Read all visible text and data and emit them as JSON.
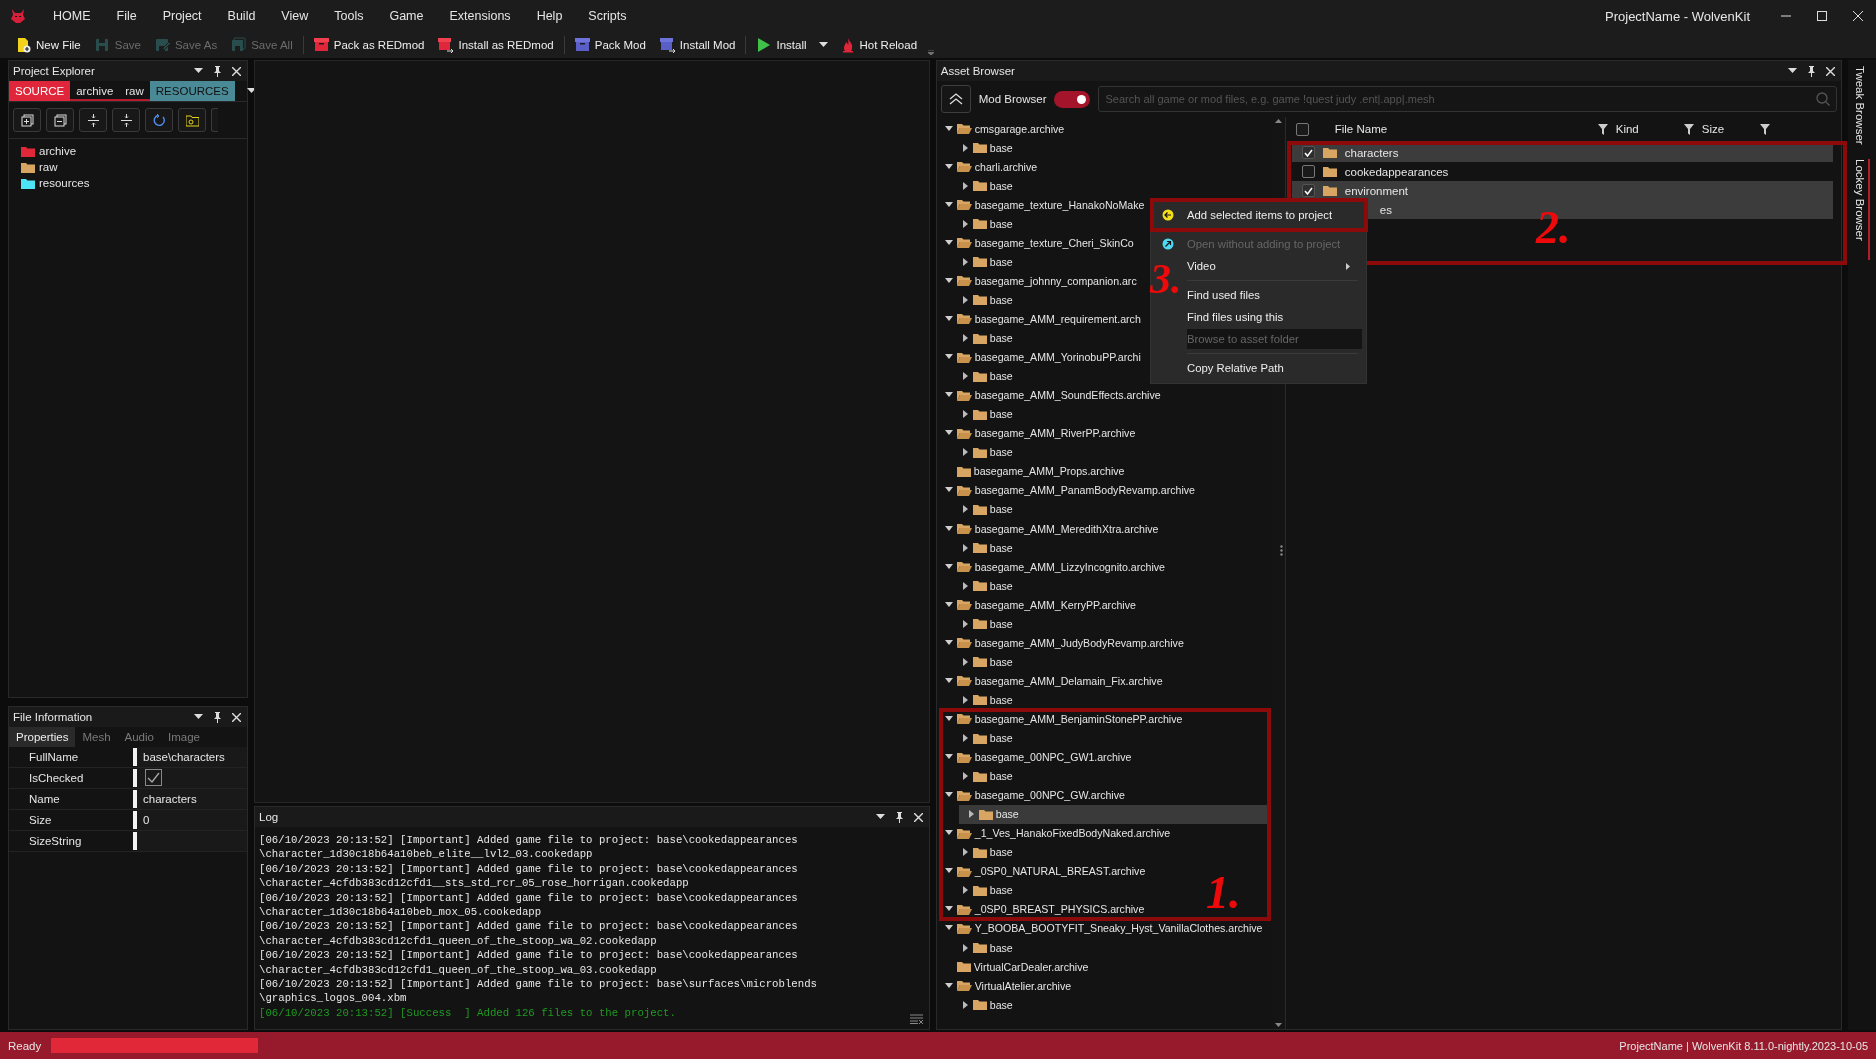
{
  "window": {
    "title": "ProjectName - WolvenKit"
  },
  "menu": [
    "HOME",
    "File",
    "Project",
    "Build",
    "View",
    "Tools",
    "Game",
    "Extensions",
    "Help",
    "Scripts"
  ],
  "toolbar": [
    [
      {
        "label": "New File",
        "kind": "new",
        "disabled": false
      },
      {
        "label": "Save",
        "kind": "save",
        "disabled": true
      },
      {
        "label": "Save As",
        "kind": "save-as",
        "disabled": true
      },
      {
        "label": "Save All",
        "kind": "save-all",
        "disabled": true
      }
    ],
    [
      {
        "label": "Pack as REDmod",
        "kind": "pack-red",
        "disabled": false
      },
      {
        "label": "Install as REDmod",
        "kind": "install-red",
        "disabled": false
      }
    ],
    [
      {
        "label": "Pack Mod",
        "kind": "pack-blue",
        "disabled": false
      },
      {
        "label": "Install Mod",
        "kind": "install-blue",
        "disabled": false
      }
    ],
    [
      {
        "label": "Install",
        "kind": "play",
        "disabled": false,
        "dropdown": true
      },
      {
        "label": "Hot Reload",
        "kind": "flame",
        "disabled": false
      }
    ]
  ],
  "project_explorer": {
    "title": "Project Explorer",
    "tabs": [
      {
        "label": "SOURCE",
        "color": "#e0263a"
      },
      {
        "label": "archive"
      },
      {
        "label": "raw"
      },
      {
        "label": "RESOURCES",
        "color": "#4a8a96"
      }
    ],
    "tree": [
      {
        "label": "archive",
        "color": "#e0283a"
      },
      {
        "label": "raw",
        "color": "#d8a662"
      },
      {
        "label": "resources",
        "color": "#4ee3f5"
      }
    ]
  },
  "file_information": {
    "title": "File Information",
    "tabs": [
      {
        "label": "Properties",
        "selected": true
      },
      {
        "label": "Mesh",
        "selected": false
      },
      {
        "label": "Audio",
        "selected": false
      },
      {
        "label": "Image",
        "selected": false
      }
    ],
    "properties": [
      {
        "name": "FullName",
        "kind": "text",
        "value": "base\\characters"
      },
      {
        "name": "IsChecked",
        "kind": "checkbox",
        "checked": true
      },
      {
        "name": "Name",
        "kind": "text",
        "value": "characters"
      },
      {
        "name": "Size",
        "kind": "text",
        "value": "0"
      },
      {
        "name": "SizeString",
        "kind": "empty"
      }
    ]
  },
  "log": {
    "title": "Log",
    "lines": [
      {
        "text": "[06/10/2023 20:13:52] [Important] Added game file to project: base\\cookedappearances",
        "kind": "info"
      },
      {
        "text": "\\character_1d30c18b64a10beb_elite__lvl2_03.cookedapp",
        "kind": "info"
      },
      {
        "text": "[06/10/2023 20:13:52] [Important] Added game file to project: base\\cookedappearances",
        "kind": "info"
      },
      {
        "text": "\\character_4cfdb383cd12cfd1__sts_std_rcr_05_rose_horrigan.cookedapp",
        "kind": "info"
      },
      {
        "text": "[06/10/2023 20:13:52] [Important] Added game file to project: base\\cookedappearances",
        "kind": "info"
      },
      {
        "text": "\\character_1d30c18b64a10beb_mox_05.cookedapp",
        "kind": "info"
      },
      {
        "text": "[06/10/2023 20:13:52] [Important] Added game file to project: base\\cookedappearances",
        "kind": "info"
      },
      {
        "text": "\\character_4cfdb383cd12cfd1_queen_of_the_stoop_wa_02.cookedapp",
        "kind": "info"
      },
      {
        "text": "[06/10/2023 20:13:52] [Important] Added game file to project: base\\cookedappearances",
        "kind": "info"
      },
      {
        "text": "\\character_4cfdb383cd12cfd1_queen_of_the_stoop_wa_03.cookedapp",
        "kind": "info"
      },
      {
        "text": "[06/10/2023 20:13:52] [Important] Added game file to project: base\\surfaces\\microblends",
        "kind": "info"
      },
      {
        "text": "\\graphics_logos_004.xbm",
        "kind": "info"
      },
      {
        "text": "[06/10/2023 20:13:52] [Success  ] Added 126 files to the project.",
        "kind": "success"
      }
    ]
  },
  "asset_browser": {
    "title": "Asset Browser",
    "mod_browser": {
      "label": "Mod Browser",
      "on": true
    },
    "search": {
      "placeholder": "Search all game or mod files, e.g. game !quest judy .ent|.app|.mesh"
    },
    "tree": [
      {
        "label": "cmsgarage.archive",
        "expanded": true,
        "selected": false,
        "children": [
          {
            "label": "base",
            "expanded": false,
            "selected": false
          }
        ]
      },
      {
        "label": "charli.archive",
        "expanded": true,
        "selected": false,
        "children": [
          {
            "label": "base",
            "expanded": false,
            "selected": false
          }
        ]
      },
      {
        "label": "basegame_texture_HanakoNoMake",
        "expanded": true,
        "selected": false,
        "children": [
          {
            "label": "base",
            "expanded": false,
            "selected": false
          }
        ]
      },
      {
        "label": "basegame_texture_Cheri_SkinCo",
        "expanded": true,
        "selected": false,
        "children": [
          {
            "label": "base",
            "expanded": false,
            "selected": false
          }
        ]
      },
      {
        "label": "basegame_johnny_companion.arc",
        "expanded": true,
        "selected": false,
        "children": [
          {
            "label": "base",
            "expanded": false,
            "selected": false
          }
        ]
      },
      {
        "label": "basegame_AMM_requirement.arch",
        "expanded": true,
        "selected": false,
        "children": [
          {
            "label": "base",
            "expanded": false,
            "selected": false
          }
        ]
      },
      {
        "label": "basegame_AMM_YorinobuPP.archi",
        "expanded": true,
        "selected": false,
        "children": [
          {
            "label": "base",
            "expanded": false,
            "selected": false
          }
        ]
      },
      {
        "label": "basegame_AMM_SoundEffects.archive",
        "expanded": true,
        "selected": false,
        "children": [
          {
            "label": "base",
            "expanded": false,
            "selected": false
          }
        ]
      },
      {
        "label": "basegame_AMM_RiverPP.archive",
        "expanded": true,
        "selected": false,
        "children": [
          {
            "label": "base",
            "expanded": false,
            "selected": false
          }
        ]
      },
      {
        "label": "basegame_AMM_Props.archive",
        "selected": false
      },
      {
        "label": "basegame_AMM_PanamBodyRevamp.archive",
        "expanded": true,
        "selected": false,
        "children": [
          {
            "label": "base",
            "expanded": false,
            "selected": false
          }
        ]
      },
      {
        "label": "basegame_AMM_MeredithXtra.archive",
        "expanded": true,
        "selected": false,
        "children": [
          {
            "label": "base",
            "expanded": false,
            "selected": false
          }
        ]
      },
      {
        "label": "basegame_AMM_LizzyIncognito.archive",
        "expanded": true,
        "selected": false,
        "children": [
          {
            "label": "base",
            "expanded": false,
            "selected": false
          }
        ]
      },
      {
        "label": "basegame_AMM_KerryPP.archive",
        "expanded": true,
        "selected": false,
        "children": [
          {
            "label": "base",
            "expanded": false,
            "selected": false
          }
        ]
      },
      {
        "label": "basegame_AMM_JudyBodyRevamp.archive",
        "expanded": true,
        "selected": false,
        "children": [
          {
            "label": "base",
            "expanded": false,
            "selected": false
          }
        ]
      },
      {
        "label": "basegame_AMM_Delamain_Fix.archive",
        "expanded": true,
        "selected": false,
        "children": [
          {
            "label": "base",
            "expanded": false,
            "selected": false
          }
        ]
      },
      {
        "label": "basegame_AMM_BenjaminStonePP.archive",
        "expanded": true,
        "selected": false,
        "children": [
          {
            "label": "base",
            "expanded": false,
            "selected": false
          }
        ]
      },
      {
        "label": "basegame_00NPC_GW1.archive",
        "expanded": true,
        "selected": false,
        "children": [
          {
            "label": "base",
            "expanded": false,
            "selected": false
          }
        ]
      },
      {
        "label": "basegame_00NPC_GW.archive",
        "expanded": true,
        "selected": false,
        "children": [
          {
            "label": "base",
            "expanded": false,
            "selected": true
          }
        ]
      },
      {
        "label": "_1_Ves_HanakoFixedBodyNaked.archive",
        "expanded": true,
        "selected": false,
        "children": [
          {
            "label": "base",
            "expanded": false,
            "selected": false
          }
        ]
      },
      {
        "label": "_0SP0_NATURAL_BREAST.archive",
        "expanded": true,
        "selected": false,
        "children": [
          {
            "label": "base",
            "expanded": false,
            "selected": false
          }
        ]
      },
      {
        "label": "_0SP0_BREAST_PHYSICS.archive",
        "expanded": true,
        "selected": false
      },
      {
        "label": "Y_BOOBA_BOOTYFIT_Sneaky_Hyst_VanillaClothes.archive",
        "expanded": true,
        "selected": false,
        "children": [
          {
            "label": "base",
            "expanded": false,
            "selected": false
          }
        ]
      },
      {
        "label": "VirtualCarDealer.archive",
        "selected": false
      },
      {
        "label": "VirtualAtelier.archive",
        "expanded": true,
        "selected": false,
        "children": [
          {
            "label": "base",
            "expanded": false,
            "selected": false
          }
        ]
      }
    ],
    "file_list": {
      "columns": [
        "File Name",
        "Kind",
        "Size"
      ],
      "all_checked": false,
      "rows": [
        {
          "name": "characters",
          "checked": true,
          "selected": true
        },
        {
          "name": "cookedappearances",
          "checked": false,
          "selected": false
        },
        {
          "name": "environment",
          "checked": true,
          "selected": true
        },
        {
          "name": "es",
          "selected": true
        }
      ]
    }
  },
  "side_tabs": [
    {
      "label": "Tweak Browser",
      "selected": false
    },
    {
      "label": "Lockey Browser",
      "selected": true
    }
  ],
  "context_menu": [
    {
      "kind": "item",
      "label": "Add selected items to project",
      "disabled": false,
      "highlighted": false
    },
    {
      "kind": "separator"
    },
    {
      "kind": "item",
      "label": "Open without adding to project",
      "disabled": true,
      "highlighted": false
    },
    {
      "kind": "item",
      "label": "Video",
      "disabled": false,
      "highlighted": false,
      "submenu": true
    },
    {
      "kind": "separator"
    },
    {
      "kind": "item",
      "label": "Find used files",
      "disabled": false,
      "highlighted": false
    },
    {
      "kind": "item",
      "label": "Find files using this",
      "disabled": false,
      "highlighted": false
    },
    {
      "kind": "item",
      "label": "Browse to asset folder",
      "disabled": true,
      "highlighted": true
    },
    {
      "kind": "separator"
    },
    {
      "kind": "item",
      "label": "Copy Relative Path",
      "disabled": false,
      "highlighted": false
    }
  ],
  "annotations": [
    {
      "label": "1."
    },
    {
      "label": "2."
    },
    {
      "label": "3."
    }
  ],
  "status_bar": {
    "text": "Ready",
    "progress": {
      "level": 1
    },
    "info": "ProjectName | WolvenKit 8.11.0-nightly.2023-10-05"
  }
}
